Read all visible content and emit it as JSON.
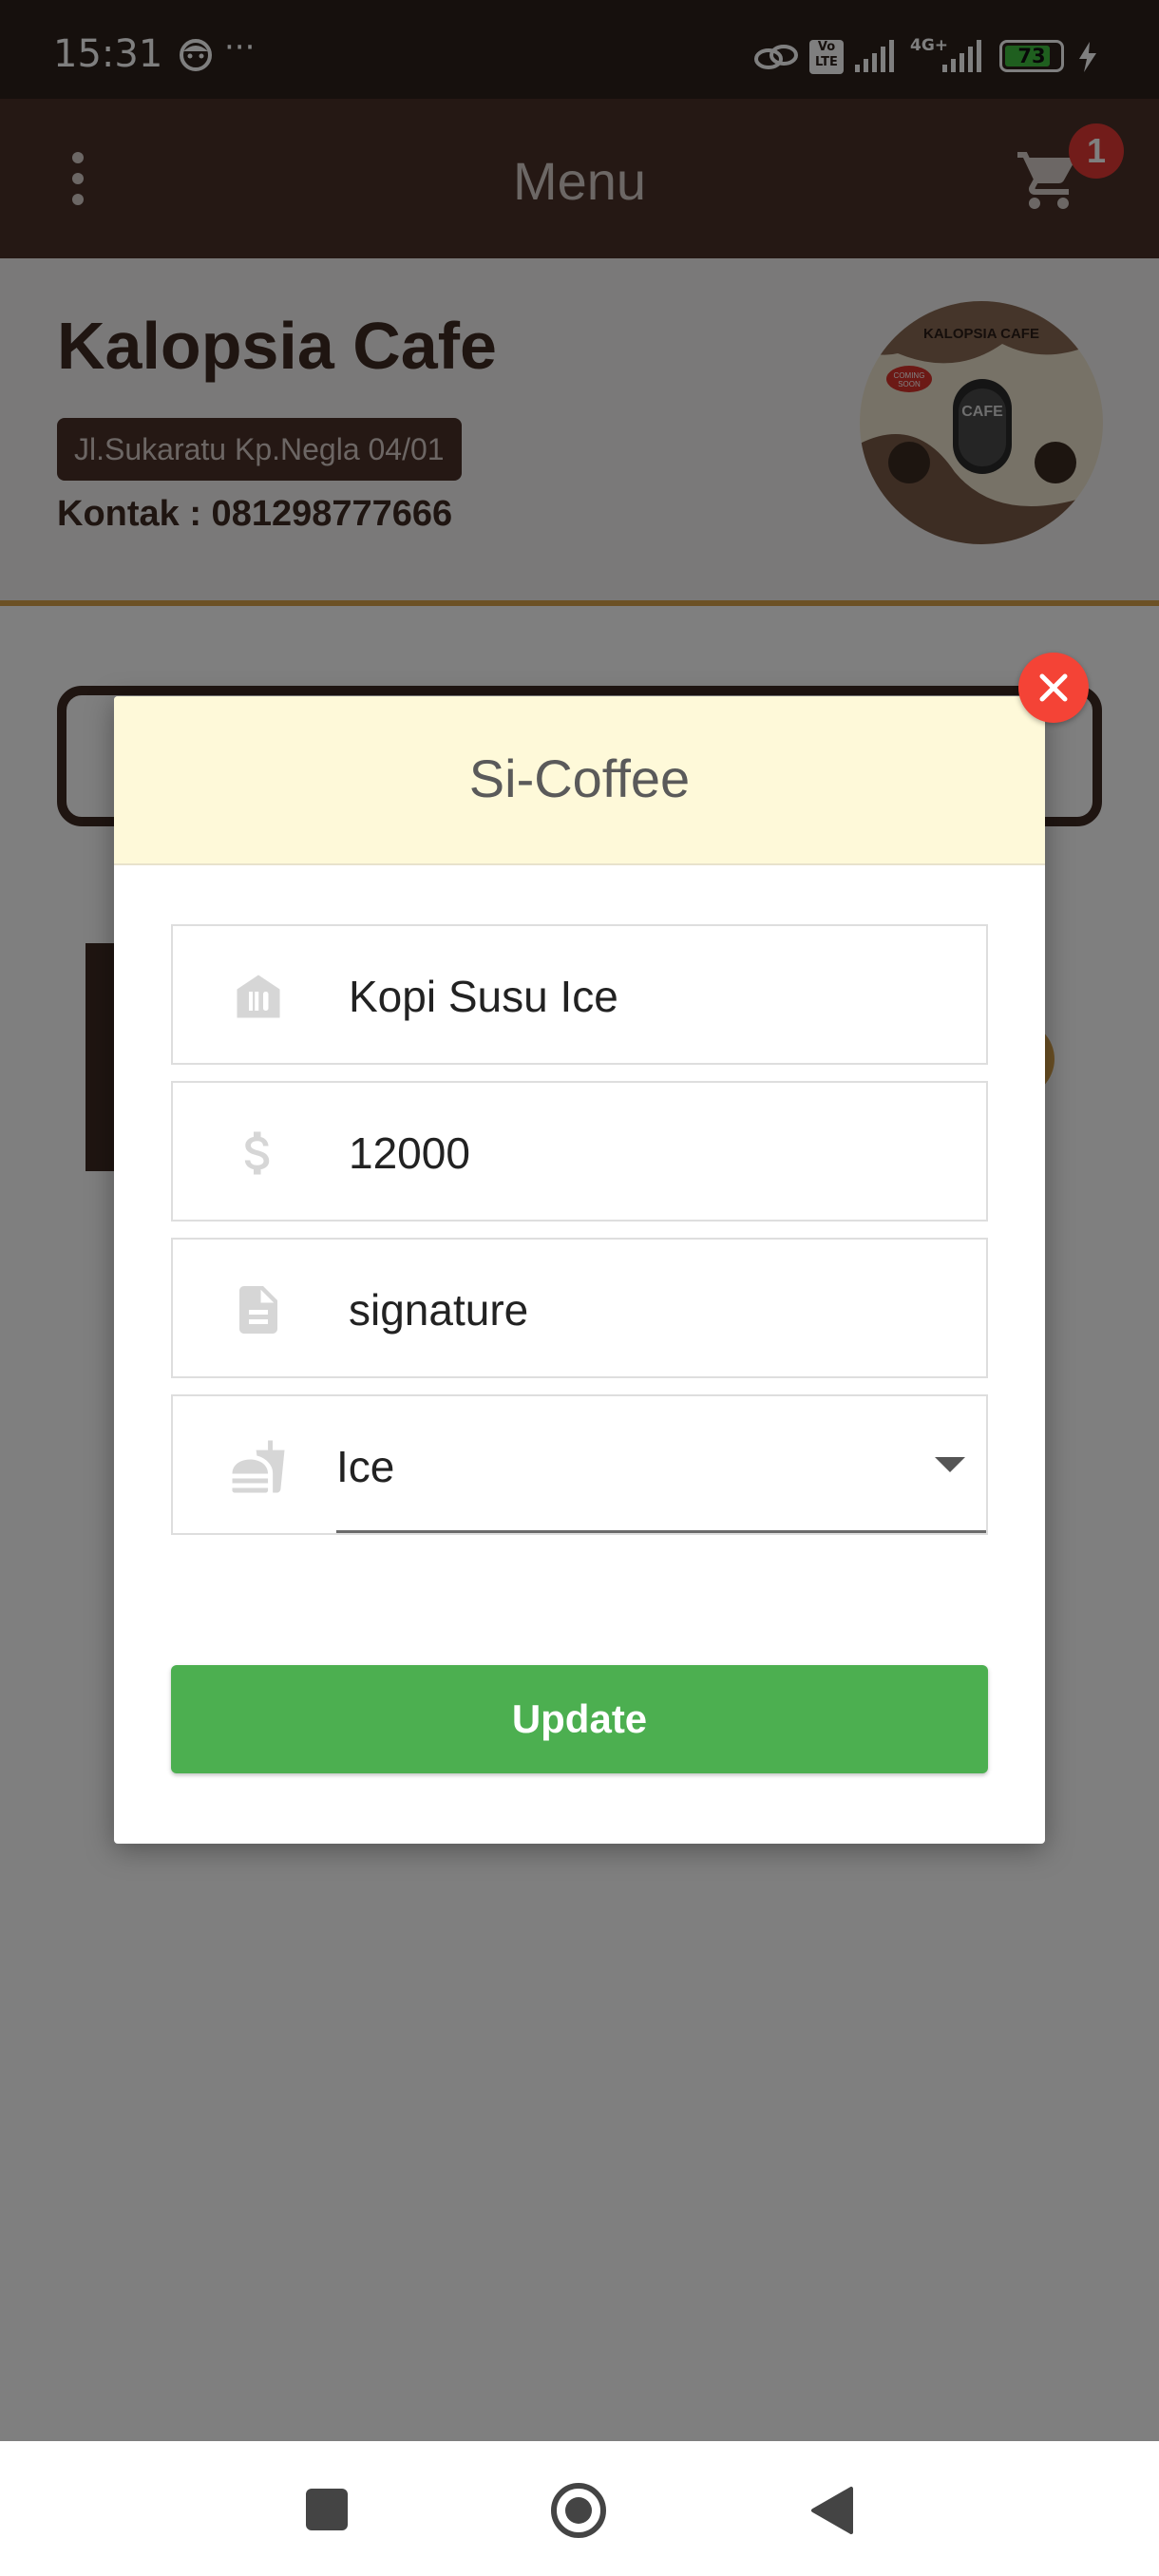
{
  "status_bar": {
    "time": "15:31",
    "battery": "73",
    "network": "4G+"
  },
  "header": {
    "title": "Menu",
    "cart_count": "1"
  },
  "cafe": {
    "name": "Kalopsia Cafe",
    "address": "Jl.Sukaratu Kp.Negla 04/01",
    "contact": "Kontak : 081298777666",
    "logo_text": "KALOPSIA CAFE",
    "logo_badge": "COMING SOON",
    "logo_sign": "CAFE"
  },
  "modal": {
    "title": "Si-Coffee",
    "name_value": "Kopi Susu Ice",
    "price_value": "12000",
    "description_value": "signature",
    "category_value": "Ice",
    "update_label": "Update"
  },
  "colors": {
    "brand_dark": "#4a3128",
    "accent_gold": "#d9a34a",
    "update_green": "#4caf50",
    "close_red": "#f44336",
    "modal_header": "#fef9d9"
  },
  "icons": {
    "menu": "more-vert-icon",
    "cart": "cart-icon",
    "close": "close-icon",
    "name": "restaurant-icon",
    "price": "dollar-icon",
    "description": "document-icon",
    "category": "food-category-icon"
  }
}
